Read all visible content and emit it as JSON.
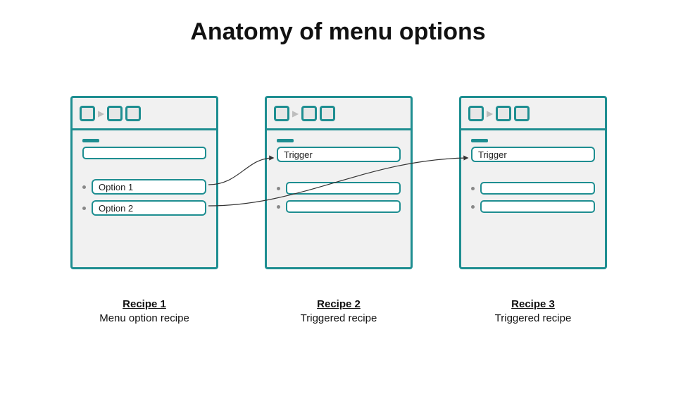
{
  "title": "Anatomy of menu options",
  "cards": {
    "c1": {
      "option1": "Option 1",
      "option2": "Option 2"
    },
    "c2": {
      "trigger": "Trigger"
    },
    "c3": {
      "trigger": "Trigger"
    }
  },
  "captions": {
    "r1": {
      "title": "Recipe 1",
      "sub": "Menu option recipe"
    },
    "r2": {
      "title": "Recipe 2",
      "sub": "Triggered recipe"
    },
    "r3": {
      "title": "Recipe 3",
      "sub": "Triggered recipe"
    }
  }
}
